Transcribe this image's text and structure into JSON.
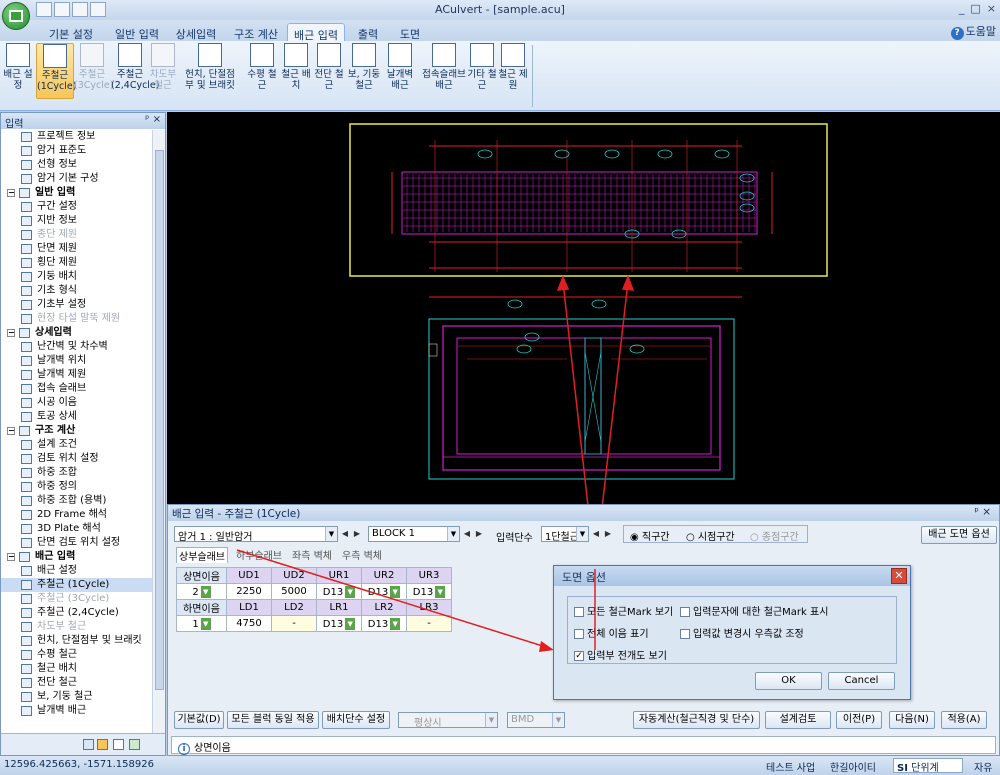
{
  "window": {
    "title": "ACulvert - [sample.acu]",
    "controls": [
      "_",
      "□",
      "×"
    ]
  },
  "tabs": [
    "기본 설정",
    "일반 입력",
    "상세입력",
    "구조 계산",
    "배근 입력",
    "출력",
    "도면"
  ],
  "help_label": "도움말",
  "ribbon": [
    {
      "label": "배근 설정",
      "state": "normal"
    },
    {
      "label": "주철근 (1Cycle)",
      "state": "selected"
    },
    {
      "label": "주철근 (3Cycle)",
      "state": "disabled"
    },
    {
      "label": "주철근 (2,4Cycle)",
      "state": "normal"
    },
    {
      "label": "차도부 철근",
      "state": "disabled"
    },
    {
      "label": "헌치, 단절점부 및 브래킷",
      "state": "normal"
    },
    {
      "label": "수평 철근",
      "state": "normal"
    },
    {
      "label": "철근 배치",
      "state": "normal"
    },
    {
      "label": "전단 철근",
      "state": "normal"
    },
    {
      "label": "보, 기둥 철근",
      "state": "normal"
    },
    {
      "label": "날개벽 배근",
      "state": "normal"
    },
    {
      "label": "접속슬래브 배근",
      "state": "normal"
    },
    {
      "label": "기타 철근",
      "state": "normal"
    },
    {
      "label": "철근 제원",
      "state": "normal"
    }
  ],
  "left_panel": {
    "title": "입력",
    "items": [
      {
        "label": "프로젝트 정보",
        "type": "item"
      },
      {
        "label": "암거 표준도",
        "type": "item"
      },
      {
        "label": "선형 정보",
        "type": "item"
      },
      {
        "label": "암거 기본 구성",
        "type": "item"
      },
      {
        "label": "일반 입력",
        "type": "group"
      },
      {
        "label": "구간 설정",
        "type": "item"
      },
      {
        "label": "지반 정보",
        "type": "item"
      },
      {
        "label": "종단 제원",
        "type": "disabled"
      },
      {
        "label": "단면 제원",
        "type": "item"
      },
      {
        "label": "횡단 제원",
        "type": "item"
      },
      {
        "label": "기둥 배치",
        "type": "item"
      },
      {
        "label": "기초 형식",
        "type": "item"
      },
      {
        "label": "기초부 설정",
        "type": "item"
      },
      {
        "label": "현장 타설 말뚝 제원",
        "type": "disabled"
      },
      {
        "label": "상세입력",
        "type": "group"
      },
      {
        "label": "난간벽 및 차수벽",
        "type": "item"
      },
      {
        "label": "날개벽 위치",
        "type": "item"
      },
      {
        "label": "날개벽 제원",
        "type": "item"
      },
      {
        "label": "접속 슬래브",
        "type": "item"
      },
      {
        "label": "시공 이음",
        "type": "item"
      },
      {
        "label": "토공 상세",
        "type": "item"
      },
      {
        "label": "구조 계산",
        "type": "group"
      },
      {
        "label": "설계 조건",
        "type": "item"
      },
      {
        "label": "검토 위치 설정",
        "type": "item"
      },
      {
        "label": "하중 조합",
        "type": "item"
      },
      {
        "label": "하중 정의",
        "type": "item"
      },
      {
        "label": "하중 조합 (용벽)",
        "type": "item"
      },
      {
        "label": "2D Frame 해석",
        "type": "item"
      },
      {
        "label": "3D Plate 해석",
        "type": "item"
      },
      {
        "label": "단면 검토 위치 설정",
        "type": "item"
      },
      {
        "label": "배근 입력",
        "type": "group"
      },
      {
        "label": "배근 설정",
        "type": "item"
      },
      {
        "label": "주철근 (1Cycle)",
        "type": "selected"
      },
      {
        "label": "주철근 (3Cycle)",
        "type": "disabled"
      },
      {
        "label": "주철근 (2,4Cycle)",
        "type": "item"
      },
      {
        "label": "차도부 철근",
        "type": "disabled"
      },
      {
        "label": "헌치, 단절점부 및 브래킷",
        "type": "item"
      },
      {
        "label": "수평 철근",
        "type": "item"
      },
      {
        "label": "철근 배치",
        "type": "item"
      },
      {
        "label": "전단 철근",
        "type": "item"
      },
      {
        "label": "보, 기둥 철근",
        "type": "item"
      },
      {
        "label": "날개벽 배근",
        "type": "item"
      }
    ]
  },
  "bottom_panel": {
    "title": "배근 입력 - 주철근 (1Cycle)",
    "culvert_combo": "암거 1 : 일반암거",
    "block_combo": "BLOCK  1",
    "input_stage_label": "입력단수",
    "input_stage_value": "1단철근",
    "radios": [
      "직구간",
      "시점구간",
      "종점구간"
    ],
    "option_button": "배근 도면 옵션",
    "subtabs": [
      "상부슬래브",
      "하부슬래브",
      "좌측 벽체",
      "우측 벽체"
    ],
    "grid": {
      "top_headers": [
        "상면이음",
        "UD1",
        "UD2",
        "UR1",
        "UR2",
        "UR3"
      ],
      "top_values": [
        "2",
        "2250",
        "5000",
        "D13",
        "D13",
        "D13"
      ],
      "bottom_headers": [
        "하면이음",
        "LD1",
        "LD2",
        "LR1",
        "LR2",
        "LR3"
      ],
      "bottom_values": [
        "1",
        "4750",
        "-",
        "D13",
        "D13",
        "-"
      ]
    },
    "buttons_left": [
      "기본값(D)",
      "모든 블럭 동일 적용",
      "배치단수 설정"
    ],
    "disabled_combos": [
      "평상시",
      "BMD"
    ],
    "buttons_right": [
      "자동계산(철근직경 및 단수)",
      "설계검토",
      "이전(P)",
      "다음(N)",
      "적용(A)"
    ],
    "info": "상면이음"
  },
  "dialog": {
    "title": "도면 옵션",
    "checks": [
      {
        "label": "모든 철근Mark 보기",
        "checked": false
      },
      {
        "label": "입력문자에 대한 철근Mark 표시",
        "checked": false
      },
      {
        "label": "전체 이음 표기",
        "checked": false
      },
      {
        "label": "입력값 변경시 우측값 조정",
        "checked": false
      },
      {
        "label": "입력부 전개도 보기",
        "checked": true
      }
    ],
    "ok": "OK",
    "cancel": "Cancel"
  },
  "status": {
    "coords": "12596.425663,  -1571.158926",
    "project": "테스트 사업",
    "company": "한길아이티",
    "unit_prefix": "SI",
    "unit": "단위계",
    "mode": "자유"
  },
  "colors": {
    "accent": "#f7c65a",
    "arrow": "#e02020",
    "cad_bg": "#000000",
    "highlight_box": "#e8e84a"
  }
}
